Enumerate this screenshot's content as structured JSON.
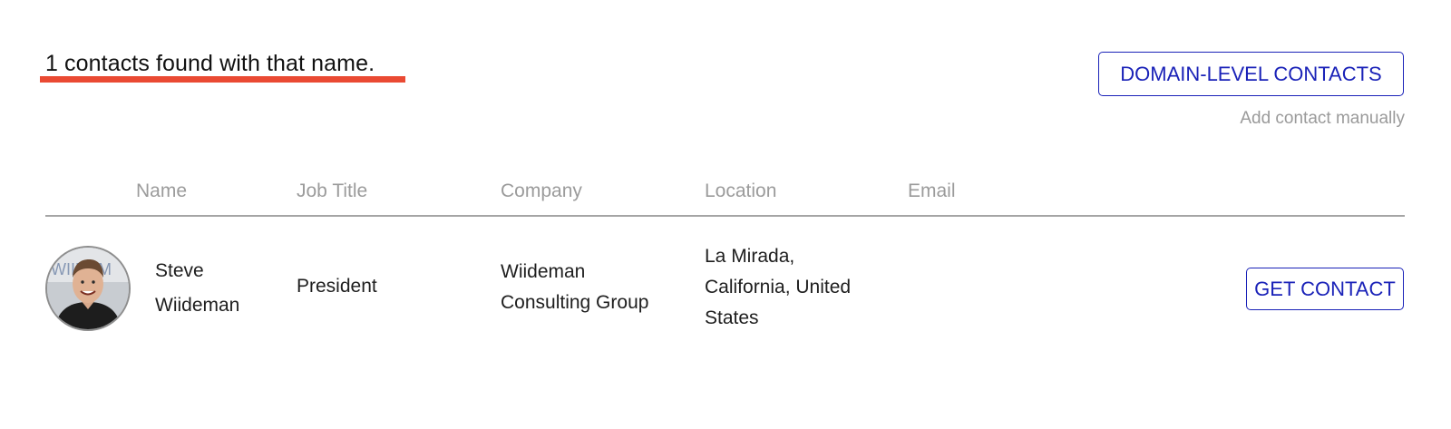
{
  "results": {
    "title": "1 contacts found with that name."
  },
  "actions": {
    "domain_button_label": "DOMAIN-LEVEL CONTACTS",
    "add_manually_label": "Add contact manually"
  },
  "table": {
    "columns": [
      "Name",
      "Job Title",
      "Company",
      "Location",
      "Email"
    ],
    "rows": [
      {
        "avatar_icon": "person-photo-avatar",
        "name_first": "Steve",
        "name_last": "Wiideman",
        "job_title": "President",
        "company_line1": "Wiideman",
        "company_line2": "Consulting Group",
        "location_line1": "La Mirada,",
        "location_line2": "California, United",
        "location_line3": "States",
        "email": "",
        "action_label": "GET CONTACT"
      }
    ]
  },
  "colors": {
    "accent": "#1a22b8",
    "underline": "#ea4a33",
    "muted_text": "#9b9b9b"
  }
}
